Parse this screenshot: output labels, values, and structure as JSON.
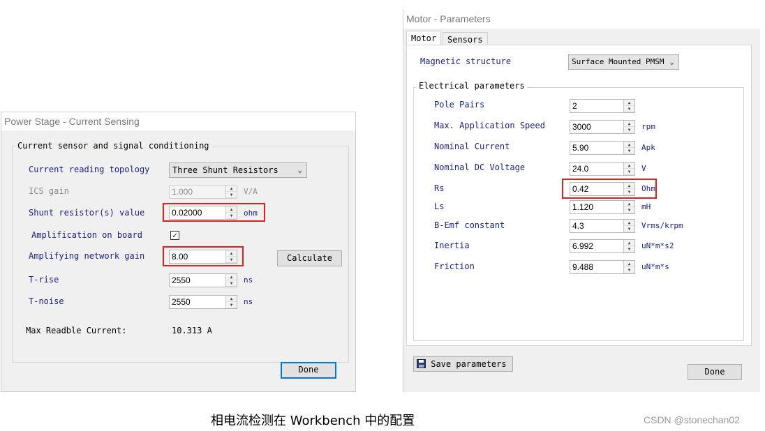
{
  "left_window": {
    "title": "Power Stage - Current Sensing",
    "group_label": "Current sensor and signal conditioning",
    "topology_label": "Current reading topology",
    "topology_value": "Three Shunt Resistors",
    "ics_label": "ICS gain",
    "ics_value": "1.000",
    "ics_unit": "V/A",
    "shunt_label": "Shunt resistor(s) value",
    "shunt_value": "0.02000",
    "shunt_unit": "ohm",
    "amp_board_label": "Amplification on board",
    "amp_board_checked": "✓",
    "amp_gain_label": "Amplifying network gain",
    "amp_gain_value": "8.00",
    "calculate_label": "Calculate",
    "trise_label": "T-rise",
    "trise_value": "2550",
    "trise_unit": "ns",
    "tnoise_label": "T-noise",
    "tnoise_value": "2550",
    "tnoise_unit": "ns",
    "max_label": "Max Readble Current:",
    "max_value": "10.313 A",
    "done_label": "Done"
  },
  "right_window": {
    "title": "Motor - Parameters",
    "tabs": [
      "Motor",
      "Sensors"
    ],
    "magnetic_label": "Magnetic structure",
    "magnetic_value": "Surface Mounted PMSM",
    "electrical_group": "Electrical parameters",
    "params": [
      {
        "label": "Pole Pairs",
        "value": "2",
        "unit": ""
      },
      {
        "label": "Max. Application Speed",
        "value": "3000",
        "unit": "rpm"
      },
      {
        "label": "Nominal Current",
        "value": "5.90",
        "unit": "Apk"
      },
      {
        "label": "Nominal DC Voltage",
        "value": "24.0",
        "unit": "V"
      },
      {
        "label": "Rs",
        "value": "0.42",
        "unit": "Ohm"
      },
      {
        "label": "Ls",
        "value": "1.120",
        "unit": "mH"
      },
      {
        "label": "B-Emf constant",
        "value": "4.3",
        "unit": "Vrms/krpm"
      },
      {
        "label": "Inertia",
        "value": "6.992",
        "unit": "uN*m*s2"
      },
      {
        "label": "Friction",
        "value": "9.488",
        "unit": "uN*m*s"
      }
    ],
    "save_label": "Save parameters",
    "done_label": "Done"
  },
  "caption": "相电流检测在 Workbench 中的配置",
  "watermark": "CSDN @stonechan02",
  "colors": {
    "highlight": "#e02020",
    "label": "#1a237e",
    "default_button": "#0078d7"
  }
}
